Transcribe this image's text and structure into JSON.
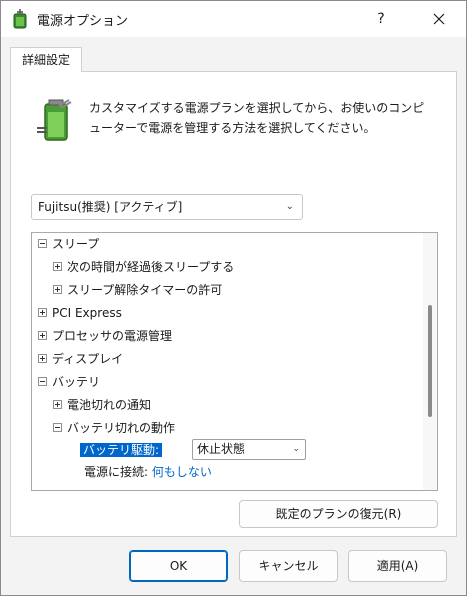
{
  "window": {
    "title": "電源オプション",
    "help": "?"
  },
  "tab": {
    "label": "詳細設定"
  },
  "description": "カスタマイズする電源プランを選択してから、お使いのコンピューターで電源を管理する方法を選択してください。",
  "plan_select": {
    "value": "Fujitsu(推奨) [アクティブ]"
  },
  "tree": {
    "items": [
      {
        "label": "スリープ",
        "state": "expanded"
      },
      {
        "label": "次の時間が経過後スリープする",
        "state": "collapsed"
      },
      {
        "label": "スリープ解除タイマーの許可",
        "state": "collapsed"
      },
      {
        "label": "PCI Express",
        "state": "collapsed"
      },
      {
        "label": "プロセッサの電源管理",
        "state": "collapsed"
      },
      {
        "label": "ディスプレイ",
        "state": "collapsed"
      },
      {
        "label": "バッテリ",
        "state": "expanded"
      },
      {
        "label": "電池切れの通知",
        "state": "collapsed"
      },
      {
        "label": "バッテリ切れの動作",
        "state": "expanded"
      }
    ],
    "battery_setting": {
      "label": "バッテリ駆動:",
      "value": "休止状態"
    },
    "plugged_setting": {
      "label": "電源に接続:",
      "value": "何もしない"
    }
  },
  "buttons": {
    "restore": "既定のプランの復元(R)",
    "ok": "OK",
    "cancel": "キャンセル",
    "apply": "適用(A)"
  },
  "colors": {
    "accent": "#0066cc",
    "selection": "#0066cc"
  },
  "icons": {
    "app": "power-options-battery-icon",
    "close": "close-icon",
    "help": "help-icon"
  }
}
